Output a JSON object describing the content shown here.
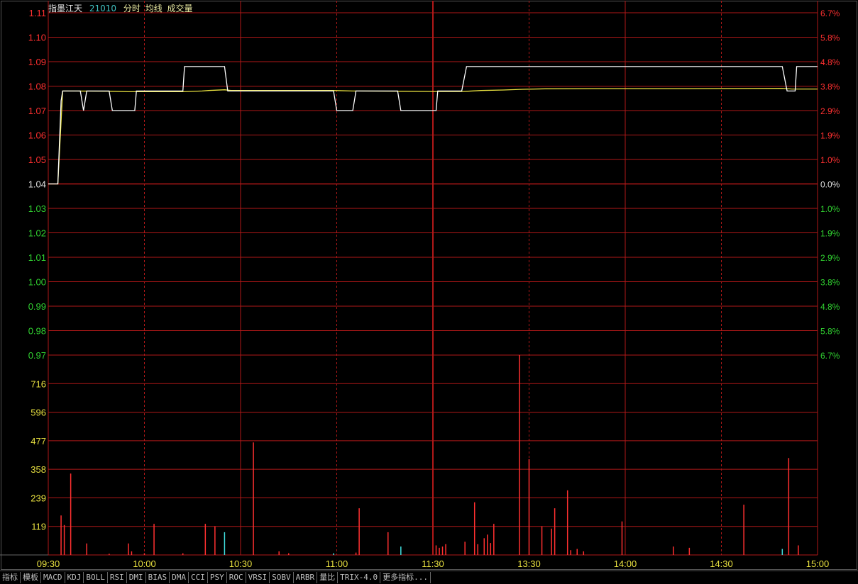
{
  "header": {
    "name": "指墨江天",
    "code": "21010",
    "items": [
      "分时",
      "均线",
      "成交量"
    ],
    "colors": {
      "name": "#e8e8e8",
      "code": "#40c0c0",
      "items": "#e8e8a0"
    }
  },
  "colors": {
    "up": "#ff3030",
    "down": "#30d030",
    "flat": "#e0e0e0",
    "grid": "#b01818",
    "price_line": "#ffffff",
    "avg_line": "#e8e040",
    "volume_axis": "#e8e040",
    "volume_down": "#40e0e0"
  },
  "tabs": [
    "指标",
    "模板",
    "MACD",
    "KDJ",
    "BOLL",
    "RSI",
    "DMI",
    "BIAS",
    "DMA",
    "CCI",
    "PSY",
    "ROC",
    "VRSI",
    "SOBV",
    "ARBR",
    "量比",
    "TRIX-4.0",
    "更多指标..."
  ],
  "chart_data": [
    {
      "type": "line",
      "price_ticks": [
        "1.11",
        "1.10",
        "1.09",
        "1.08",
        "1.07",
        "1.06",
        "1.05",
        "1.04",
        "1.03",
        "1.02",
        "1.01",
        "1.00",
        "0.99",
        "0.98",
        "0.97"
      ],
      "percent_ticks": [
        "6.7%",
        "5.8%",
        "4.8%",
        "3.8%",
        "2.9%",
        "1.9%",
        "1.0%",
        "0.0%",
        "1.0%",
        "1.9%",
        "2.9%",
        "3.8%",
        "4.8%",
        "5.8%",
        "6.7%"
      ],
      "ylim": [
        0.97,
        1.11
      ],
      "base_price": 1.04,
      "time_labels": [
        "09:30",
        "10:00",
        "10:30",
        "11:00",
        "11:30",
        "13:30",
        "14:00",
        "14:30",
        "15:00"
      ],
      "session_minutes": 240,
      "series": [
        {
          "key": "price",
          "points": [
            [
              0,
              1.04
            ],
            [
              3,
              1.04
            ],
            [
              4,
              1.074
            ],
            [
              4.5,
              1.078
            ],
            [
              10,
              1.078
            ],
            [
              11,
              1.07
            ],
            [
              12,
              1.078
            ],
            [
              19,
              1.078
            ],
            [
              20,
              1.07
            ],
            [
              27,
              1.07
            ],
            [
              27.5,
              1.078
            ],
            [
              42,
              1.078
            ],
            [
              42.5,
              1.088
            ],
            [
              55,
              1.088
            ],
            [
              56,
              1.078
            ],
            [
              89,
              1.078
            ],
            [
              90,
              1.07
            ],
            [
              95,
              1.07
            ],
            [
              96,
              1.078
            ],
            [
              109,
              1.078
            ],
            [
              110,
              1.07
            ],
            [
              121,
              1.07
            ],
            [
              121.5,
              1.078
            ],
            [
              129,
              1.078
            ],
            [
              130.5,
              1.088
            ],
            [
              229,
              1.088
            ],
            [
              230.5,
              1.078
            ],
            [
              233,
              1.078
            ],
            [
              233.5,
              1.088
            ],
            [
              240,
              1.088
            ]
          ]
        },
        {
          "key": "average",
          "points": [
            [
              0,
              1.04
            ],
            [
              3,
              1.04
            ],
            [
              4.5,
              1.078
            ],
            [
              19,
              1.0779
            ],
            [
              25,
              1.0777
            ],
            [
              27.5,
              1.0777
            ],
            [
              42,
              1.0777
            ],
            [
              48,
              1.078
            ],
            [
              50,
              1.0782
            ],
            [
              55,
              1.0785
            ],
            [
              57,
              1.0782
            ],
            [
              89,
              1.0782
            ],
            [
              95,
              1.078
            ],
            [
              109,
              1.0779
            ],
            [
              121,
              1.0778
            ],
            [
              129,
              1.0778
            ],
            [
              131,
              1.0779
            ],
            [
              135,
              1.0782
            ],
            [
              142,
              1.0784
            ],
            [
              148,
              1.0787
            ],
            [
              155,
              1.0789
            ],
            [
              170,
              1.079
            ],
            [
              200,
              1.079
            ],
            [
              229,
              1.0791
            ],
            [
              232,
              1.0788
            ],
            [
              240,
              1.0788
            ]
          ]
        }
      ]
    },
    {
      "type": "bar",
      "volume_ticks": [
        "716",
        "596",
        "477",
        "358",
        "239",
        "119"
      ],
      "ylim": [
        0,
        835
      ],
      "bars": [
        [
          4,
          165,
          "up"
        ],
        [
          5,
          125,
          "up"
        ],
        [
          7,
          340,
          "up"
        ],
        [
          12,
          48,
          "up"
        ],
        [
          19,
          5,
          "up"
        ],
        [
          25,
          48,
          "up"
        ],
        [
          26,
          15,
          "up"
        ],
        [
          30,
          7,
          "up"
        ],
        [
          33,
          130,
          "up"
        ],
        [
          42,
          7,
          "up"
        ],
        [
          49,
          130,
          "up"
        ],
        [
          52,
          120,
          "up"
        ],
        [
          55,
          95,
          "down"
        ],
        [
          64,
          470,
          "up"
        ],
        [
          72,
          15,
          "up"
        ],
        [
          75,
          7,
          "up"
        ],
        [
          89,
          7,
          "down"
        ],
        [
          96,
          10,
          "up"
        ],
        [
          97,
          195,
          "up"
        ],
        [
          106,
          95,
          "up"
        ],
        [
          110,
          35,
          "down"
        ],
        [
          121,
          40,
          "up"
        ],
        [
          122,
          30,
          "up"
        ],
        [
          123,
          35,
          "up"
        ],
        [
          124,
          45,
          "up"
        ],
        [
          130,
          55,
          "up"
        ],
        [
          133,
          220,
          "up"
        ],
        [
          134,
          45,
          "up"
        ],
        [
          136,
          70,
          "up"
        ],
        [
          137,
          85,
          "up"
        ],
        [
          138,
          50,
          "up"
        ],
        [
          139,
          130,
          "up"
        ],
        [
          147,
          835,
          "up"
        ],
        [
          150,
          400,
          "up"
        ],
        [
          154,
          120,
          "up"
        ],
        [
          157,
          110,
          "up"
        ],
        [
          158,
          195,
          "up"
        ],
        [
          162,
          270,
          "up"
        ],
        [
          163,
          20,
          "up"
        ],
        [
          165,
          25,
          "up"
        ],
        [
          167,
          15,
          "up"
        ],
        [
          179,
          140,
          "up"
        ],
        [
          195,
          35,
          "up"
        ],
        [
          200,
          30,
          "up"
        ],
        [
          217,
          210,
          "up"
        ],
        [
          229,
          25,
          "down"
        ],
        [
          231,
          405,
          "up"
        ],
        [
          234,
          40,
          "up"
        ]
      ]
    }
  ]
}
